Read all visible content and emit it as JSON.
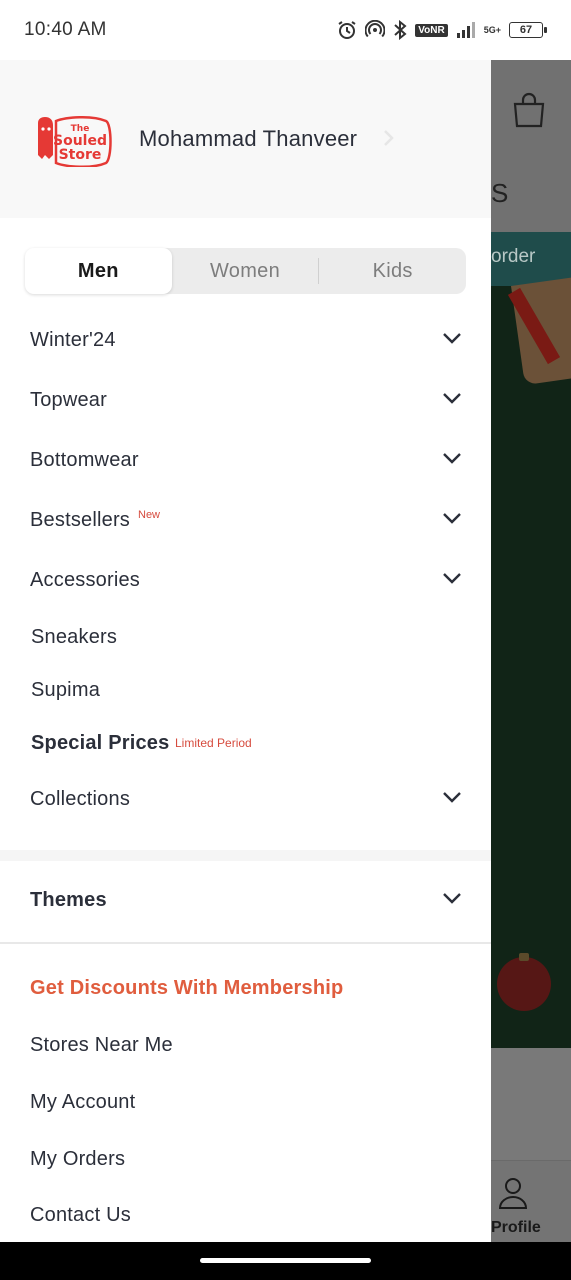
{
  "status_bar": {
    "time": "10:40 AM",
    "network": "VoNR",
    "signal_type": "5G+",
    "battery": "67"
  },
  "user": {
    "name": "Mohammad Thanveer",
    "logo_text_top": "The",
    "logo_text_mid": "Souled",
    "logo_text_bottom": "Store"
  },
  "gender_tabs": [
    {
      "label": "Men",
      "active": true
    },
    {
      "label": "Women",
      "active": false
    },
    {
      "label": "Kids",
      "active": false
    }
  ],
  "menu": {
    "winter": "Winter'24",
    "topwear": "Topwear",
    "bottomwear": "Bottomwear",
    "bestsellers": "Bestsellers",
    "bestsellers_badge": "New",
    "accessories": "Accessories",
    "sneakers": "Sneakers",
    "supima": "Supima",
    "special_prices": "Special Prices",
    "special_prices_badge": "Limited Period",
    "collections": "Collections",
    "themes": "Themes"
  },
  "links": {
    "membership": "Get Discounts With Membership",
    "stores": "Stores Near Me",
    "account": "My Account",
    "orders": "My Orders",
    "contact": "Contact Us"
  },
  "background_page": {
    "header_partial": "S",
    "banner_partial": "order",
    "profile_label": "Profile"
  },
  "colors": {
    "accent": "#e05d3e",
    "badge": "#d64b3e",
    "text": "#2b2f3a",
    "teal": "#1f4c4b"
  }
}
